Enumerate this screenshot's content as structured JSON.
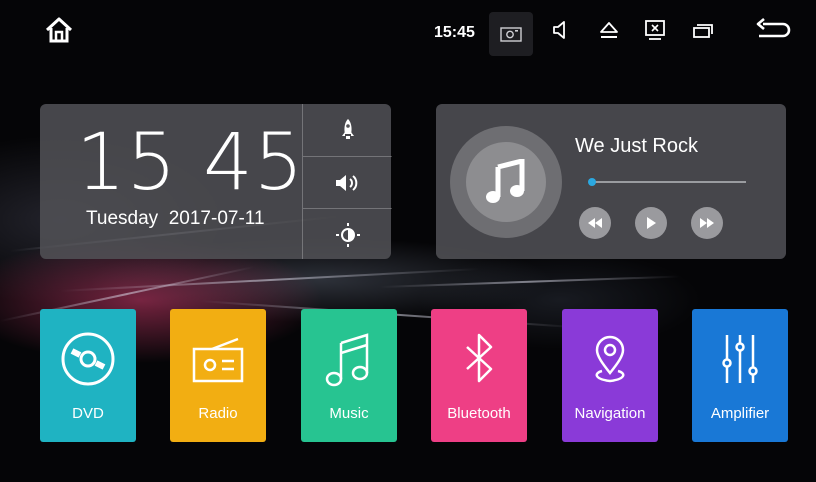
{
  "status_bar": {
    "time": "15:45",
    "icons": [
      "home-icon",
      "screenshot-icon",
      "volume-icon",
      "eject-icon",
      "close-screen-icon",
      "recent-apps-icon",
      "back-icon"
    ]
  },
  "clock_widget": {
    "hour": "15",
    "minute": "45",
    "day": "Tuesday",
    "date": "2017-07-11",
    "quick_buttons": [
      "rocket-icon",
      "volume-up-icon",
      "brightness-icon"
    ]
  },
  "music_widget": {
    "song_title": "We Just Rock",
    "progress": 0.02,
    "controls": [
      "rewind-icon",
      "play-icon",
      "fast-forward-icon"
    ],
    "accent_color": "#2ba8e0"
  },
  "apps": [
    {
      "label": "DVD",
      "color": "#1fb3c2",
      "icon": "dvd-icon"
    },
    {
      "label": "Radio",
      "color": "#f2ae12",
      "icon": "radio-icon"
    },
    {
      "label": "Music",
      "color": "#27c491",
      "icon": "music-note-icon"
    },
    {
      "label": "Bluetooth",
      "color": "#ee3f85",
      "icon": "bluetooth-icon"
    },
    {
      "label": "Navigation",
      "color": "#8a3ad8",
      "icon": "navigation-pin-icon"
    },
    {
      "label": "Amplifier",
      "color": "#1978d6",
      "icon": "equalizer-icon"
    }
  ]
}
